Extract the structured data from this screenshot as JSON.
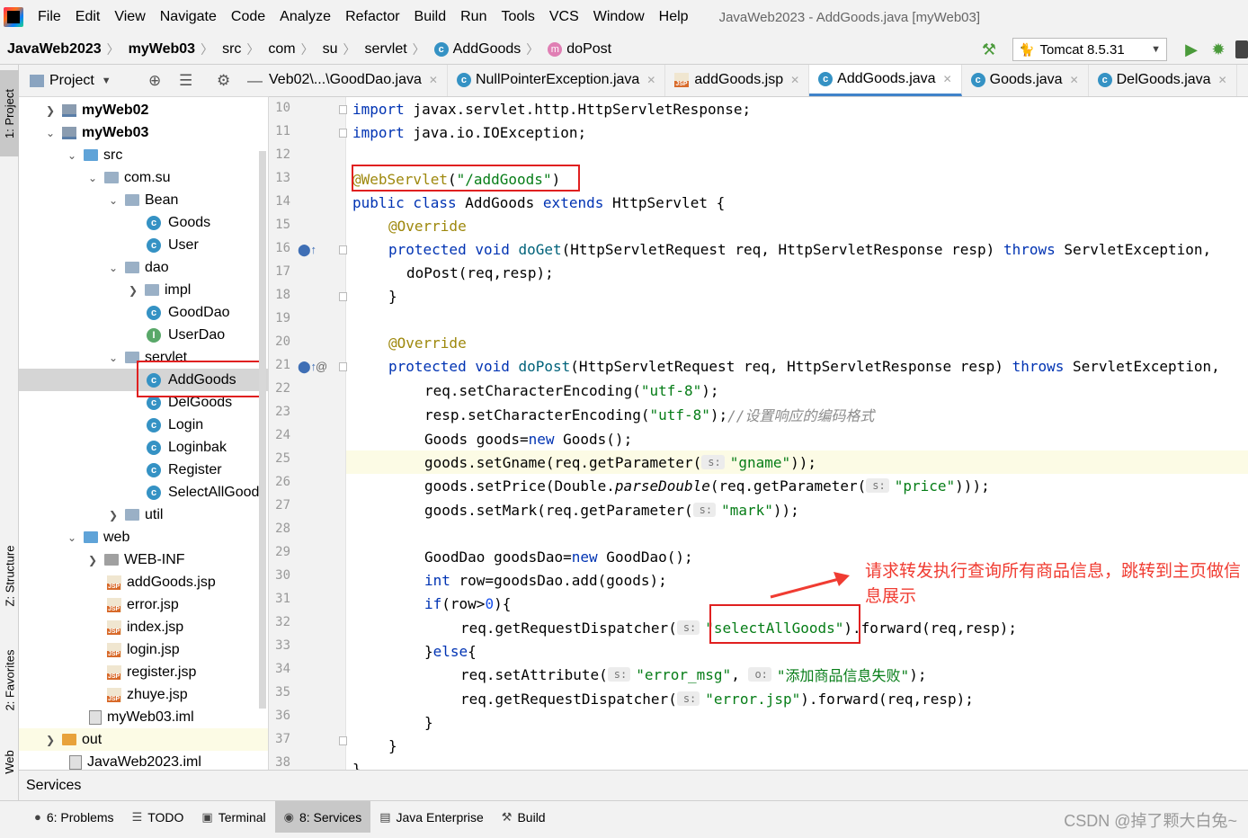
{
  "menu": {
    "items": [
      "File",
      "Edit",
      "View",
      "Navigate",
      "Code",
      "Analyze",
      "Refactor",
      "Build",
      "Run",
      "Tools",
      "VCS",
      "Window",
      "Help"
    ],
    "window_title": "JavaWeb2023 - AddGoods.java [myWeb03]"
  },
  "nav": {
    "crumbs": [
      "JavaWeb2023",
      "myWeb03",
      "src",
      "com",
      "su",
      "servlet",
      "AddGoods",
      "doPost"
    ],
    "run_config": "Tomcat 8.5.31"
  },
  "left_strip": {
    "project_tab": "1: Project",
    "structure_tab": "Z: Structure",
    "favorites_tab": "2: Favorites",
    "web_tab": "Web"
  },
  "project_panel": {
    "title": "Project",
    "tree": [
      {
        "label": "myWeb02",
        "kind": "module"
      },
      {
        "label": "myWeb03",
        "kind": "module"
      },
      {
        "label": "src",
        "kind": "folder"
      },
      {
        "label": "com.su",
        "kind": "package"
      },
      {
        "label": "Bean",
        "kind": "package"
      },
      {
        "label": "Goods",
        "kind": "class"
      },
      {
        "label": "User",
        "kind": "class"
      },
      {
        "label": "dao",
        "kind": "package"
      },
      {
        "label": "impl",
        "kind": "package"
      },
      {
        "label": "GoodDao",
        "kind": "class"
      },
      {
        "label": "UserDao",
        "kind": "interface"
      },
      {
        "label": "servlet",
        "kind": "package"
      },
      {
        "label": "AddGoods",
        "kind": "class"
      },
      {
        "label": "DelGoods",
        "kind": "class"
      },
      {
        "label": "Login",
        "kind": "class"
      },
      {
        "label": "Loginbak",
        "kind": "class"
      },
      {
        "label": "Register",
        "kind": "class"
      },
      {
        "label": "SelectAllGoods",
        "kind": "class"
      },
      {
        "label": "util",
        "kind": "package"
      },
      {
        "label": "web",
        "kind": "folder"
      },
      {
        "label": "WEB-INF",
        "kind": "folder"
      },
      {
        "label": "addGoods.jsp",
        "kind": "jsp"
      },
      {
        "label": "error.jsp",
        "kind": "jsp"
      },
      {
        "label": "index.jsp",
        "kind": "jsp"
      },
      {
        "label": "login.jsp",
        "kind": "jsp"
      },
      {
        "label": "register.jsp",
        "kind": "jsp"
      },
      {
        "label": "zhuye.jsp",
        "kind": "jsp"
      },
      {
        "label": "myWeb03.iml",
        "kind": "iml"
      },
      {
        "label": "out",
        "kind": "folder"
      },
      {
        "label": "JavaWeb2023.iml",
        "kind": "iml"
      }
    ]
  },
  "editor_tabs": [
    {
      "label": "Veb02\\...\\GoodDao.java"
    },
    {
      "label": "NullPointerException.java"
    },
    {
      "label": "addGoods.jsp"
    },
    {
      "label": "AddGoods.java"
    },
    {
      "label": "Goods.java"
    },
    {
      "label": "DelGoods.java"
    }
  ],
  "editor": {
    "line_numbers": [
      "10",
      "11",
      "12",
      "13",
      "14",
      "15",
      "16",
      "17",
      "18",
      "19",
      "20",
      "21",
      "22",
      "23",
      "24",
      "25",
      "26",
      "27",
      "28",
      "29",
      "30",
      "31",
      "32",
      "33",
      "34",
      "35",
      "36",
      "37",
      "38"
    ],
    "code": {
      "l10a": "import",
      "l10b": " javax.servlet.http.HttpServletResponse;",
      "l11a": "import",
      "l11b": " java.io.IOException;",
      "l13a": "@WebServlet",
      "l13b": "(",
      "l13c": "\"/addGoods\"",
      "l13d": ")",
      "l14a": "public class",
      "l14b": " AddGoods ",
      "l14c": "extends",
      "l14d": " HttpServlet {",
      "l15": "@Override",
      "l16a": "protected void",
      "l16b": " doGet",
      "l16c": "(HttpServletRequest req, HttpServletResponse resp) ",
      "l16d": "throws",
      "l16e": " ServletException,",
      "l17": "doPost(req,resp);",
      "l18": "}",
      "l20": "@Override",
      "l21a": "protected void",
      "l21b": " doPost",
      "l21c": "(HttpServletRequest req, HttpServletResponse resp) ",
      "l21d": "throws",
      "l21e": " ServletException,",
      "l22a": "req.setCharacterEncoding(",
      "l22b": "\"utf-8\"",
      "l22c": ");",
      "l23a": "resp.setCharacterEncoding(",
      "l23b": "\"utf-8\"",
      "l23c": ");",
      "l23d": "//设置响应的编码格式",
      "l24a": "Goods goods=",
      "l24b": "new",
      "l24c": " Goods();",
      "l25a": "goods.setGname(req.getParameter(",
      "l25hint": "s:",
      "l25b": "\"gname\"",
      "l25c": "));",
      "l26a": "goods.setPrice(Double.",
      "l26b": "parseDouble",
      "l26c": "(req.getParameter(",
      "l26hint": "s:",
      "l26d": "\"price\"",
      "l26e": ")));",
      "l27a": "goods.setMark(req.getParameter(",
      "l27hint": "s:",
      "l27b": "\"mark\"",
      "l27c": "));",
      "l29a": "GoodDao goodsDao=",
      "l29b": "new",
      "l29c": " GoodDao();",
      "l30a": "int",
      "l30b": " row=goodsDao.add(goods);",
      "l31a": "if",
      "l31b": "(row>",
      "l31c": "0",
      "l31d": "){",
      "l32a": "req.getRequestDispatcher(",
      "l32hint": "s:",
      "l32b": "\"selectAllGoods\"",
      "l32c": ").forward(req,resp);",
      "l33a": "}",
      "l33b": "else",
      "l33c": "{",
      "l34a": "req.setAttribute(",
      "l34hint1": "s:",
      "l34b": "\"error_msg\"",
      "l34c": ", ",
      "l34hint2": "o:",
      "l34d": "\"添加商品信息失败\"",
      "l34e": ");",
      "l35a": "req.getRequestDispatcher(",
      "l35hint": "s:",
      "l35b": "\"error.jsp\"",
      "l35c": ").forward(req,resp);",
      "l36": "}",
      "l37": "}",
      "l38": "}"
    },
    "annotation_note": "请求转发执行查询所有商品信息，跳转到主页做信息展示"
  },
  "services_bar": {
    "label": "Services"
  },
  "bottom_tabs": [
    {
      "label": "6: Problems"
    },
    {
      "label": "TODO"
    },
    {
      "label": "Terminal"
    },
    {
      "label": "8: Services"
    },
    {
      "label": "Java Enterprise"
    },
    {
      "label": "Build"
    }
  ],
  "watermark": "CSDN @掉了颗大白兔~",
  "colors": {
    "keyword": "#0033b3",
    "string": "#067d17",
    "annotation": "#9e880d",
    "highlight_box": "#e02020",
    "note_text": "#f03c32"
  }
}
